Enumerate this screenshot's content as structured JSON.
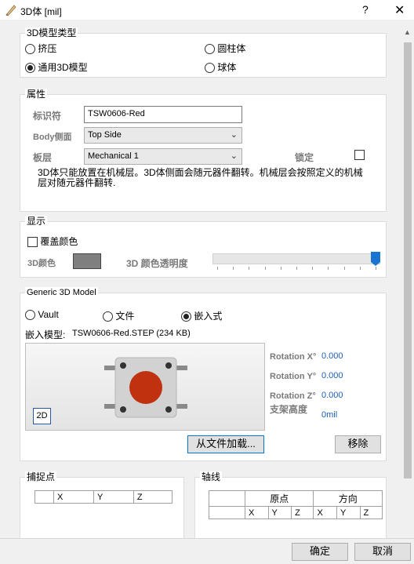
{
  "window": {
    "title": "3D体 [mil]",
    "help": "?",
    "close": "✕"
  },
  "model_type": {
    "title": "3D模型类型",
    "options": [
      {
        "label": "挤压",
        "selected": false
      },
      {
        "label": "圆柱体",
        "selected": false
      },
      {
        "label": "通用3D模型",
        "selected": true
      },
      {
        "label": "球体",
        "selected": false
      }
    ]
  },
  "properties": {
    "title": "属性",
    "identifier_label": "标识符",
    "identifier_value": "TSW0606-Red",
    "body_side_label": "Body侧面",
    "body_side_value": "Top Side",
    "layer_label": "板层",
    "layer_value": "Mechanical 1",
    "locked_label": "锁定",
    "note": "3D体只能放置在机械层。3D体侧面会随元器件翻转。机械层会按照定义的机械层对随元器件翻转."
  },
  "display": {
    "title": "显示",
    "override_color_label": "覆盖颜色",
    "color_label": "3D颜色",
    "color_value": "#7f7f7f",
    "opacity_label": "3D 颜色透明度",
    "opacity_level": 1.0
  },
  "generic_model": {
    "title": "Generic 3D Model",
    "sources": [
      {
        "label": "Vault",
        "selected": false
      },
      {
        "label": "文件",
        "selected": false
      },
      {
        "label": "嵌入式",
        "selected": true
      }
    ],
    "embedded_label": "嵌入模型:",
    "embedded_value": "TSW0606-Red.STEP (234 KB)",
    "view_badge": "2D",
    "rotation": [
      {
        "label": "Rotation X°",
        "value": "0.000"
      },
      {
        "label": "Rotation Y°",
        "value": "0.000"
      },
      {
        "label": "Rotation Z°",
        "value": "0.000"
      }
    ],
    "standoff_label": "支架高度",
    "standoff_value": "0mil",
    "load_button": "从文件加载...",
    "remove_button": "移除"
  },
  "snap_points": {
    "title": "捕捉点",
    "columns": [
      "",
      "X",
      "Y",
      "Z"
    ]
  },
  "axis": {
    "title": "轴线",
    "group_headers": [
      "原点",
      "方向"
    ],
    "columns": [
      "X",
      "Y",
      "Z",
      "X",
      "Y",
      "Z"
    ]
  },
  "footer": {
    "ok": "确定",
    "cancel": "取消"
  }
}
